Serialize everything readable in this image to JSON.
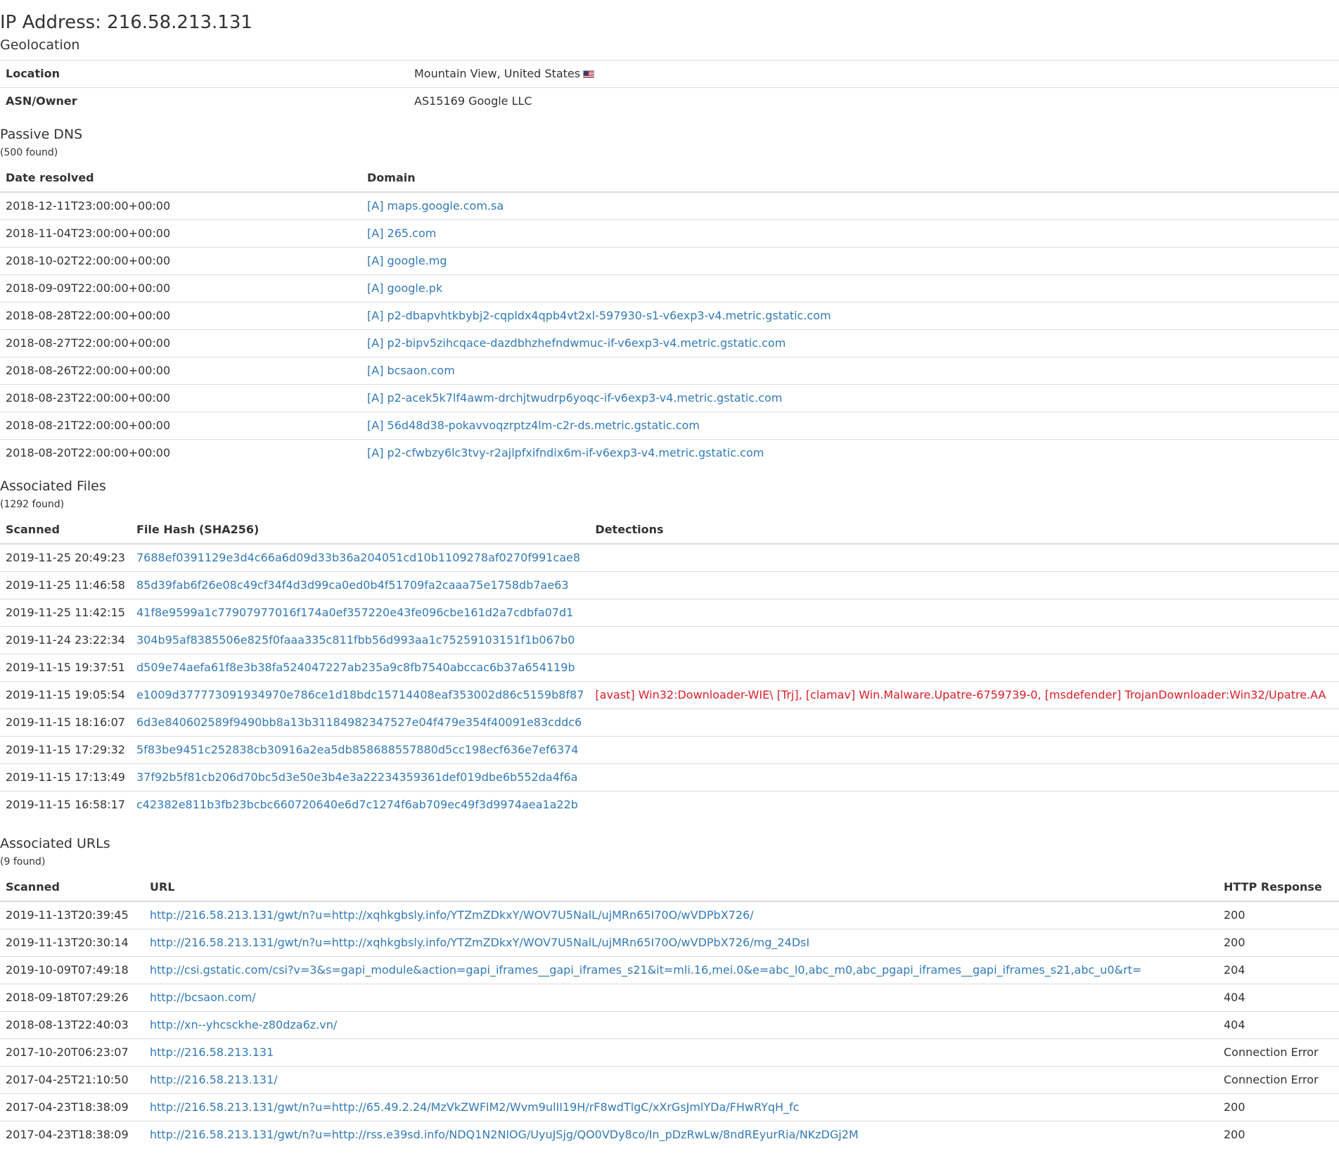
{
  "header": {
    "title": "IP Address: 216.58.213.131",
    "geolocation_heading": "Geolocation"
  },
  "geo": {
    "location_label": "Location",
    "location_value": "Mountain View, United States",
    "flag_icon": "us-flag-icon",
    "asn_label": "ASN/Owner",
    "asn_value": "AS15169 Google LLC"
  },
  "dns": {
    "heading": "Passive DNS",
    "count": "(500 found)",
    "columns": [
      "Date resolved",
      "Domain"
    ],
    "rows": [
      {
        "date": "2018-12-11T23:00:00+00:00",
        "domain": "[A] maps.google.com.sa"
      },
      {
        "date": "2018-11-04T23:00:00+00:00",
        "domain": "[A] 265.com"
      },
      {
        "date": "2018-10-02T22:00:00+00:00",
        "domain": "[A] google.mg"
      },
      {
        "date": "2018-09-09T22:00:00+00:00",
        "domain": "[A] google.pk"
      },
      {
        "date": "2018-08-28T22:00:00+00:00",
        "domain": "[A] p2-dbapvhtkbybj2-cqpldx4qpb4vt2xl-597930-s1-v6exp3-v4.metric.gstatic.com"
      },
      {
        "date": "2018-08-27T22:00:00+00:00",
        "domain": "[A] p2-bipv5zihcqace-dazdbhzhefndwmuc-if-v6exp3-v4.metric.gstatic.com"
      },
      {
        "date": "2018-08-26T22:00:00+00:00",
        "domain": "[A] bcsaon.com"
      },
      {
        "date": "2018-08-23T22:00:00+00:00",
        "domain": "[A] p2-acek5k7lf4awm-drchjtwudrp6yoqc-if-v6exp3-v4.metric.gstatic.com"
      },
      {
        "date": "2018-08-21T22:00:00+00:00",
        "domain": "[A] 56d48d38-pokavvoqzrptz4lm-c2r-ds.metric.gstatic.com"
      },
      {
        "date": "2018-08-20T22:00:00+00:00",
        "domain": "[A] p2-cfwbzy6lc3tvy-r2ajlpfxifndix6m-if-v6exp3-v4.metric.gstatic.com"
      }
    ]
  },
  "files": {
    "heading": "Associated Files",
    "count": "(1292 found)",
    "columns": [
      "Scanned",
      "File Hash (SHA256)",
      "Detections"
    ],
    "rows": [
      {
        "scanned": "2019-11-25 20:49:23",
        "hash": "7688ef0391129e3d4c66a6d09d33b36a204051cd10b1109278af0270f991cae8",
        "detections": ""
      },
      {
        "scanned": "2019-11-25 11:46:58",
        "hash": "85d39fab6f26e08c49cf34f4d3d99ca0ed0b4f51709fa2caaa75e1758db7ae63",
        "detections": ""
      },
      {
        "scanned": "2019-11-25 11:42:15",
        "hash": "41f8e9599a1c77907977016f174a0ef357220e43fe096cbe161d2a7cdbfa07d1",
        "detections": ""
      },
      {
        "scanned": "2019-11-24 23:22:34",
        "hash": "304b95af8385506e825f0faaa335c811fbb56d993aa1c75259103151f1b067b0",
        "detections": ""
      },
      {
        "scanned": "2019-11-15 19:37:51",
        "hash": "d509e74aefa61f8e3b38fa524047227ab235a9c8fb7540abccac6b37a654119b",
        "detections": ""
      },
      {
        "scanned": "2019-11-15 19:05:54",
        "hash": "e1009d377773091934970e786ce1d18bdc15714408eaf353002d86c5159b8f87",
        "detections": "[avast] Win32:Downloader-WIE\\ [Trj], [clamav] Win.Malware.Upatre-6759739-0, [msdefender] TrojanDownloader:Win32/Upatre.AA"
      },
      {
        "scanned": "2019-11-15 18:16:07",
        "hash": "6d3e840602589f9490bb8a13b31184982347527e04f479e354f40091e83cddc6",
        "detections": ""
      },
      {
        "scanned": "2019-11-15 17:29:32",
        "hash": "5f83be9451c252838cb30916a2ea5db858688557880d5cc198ecf636e7ef6374",
        "detections": ""
      },
      {
        "scanned": "2019-11-15 17:13:49",
        "hash": "37f92b5f81cb206d70bc5d3e50e3b4e3a22234359361def019dbe6b552da4f6a",
        "detections": ""
      },
      {
        "scanned": "2019-11-15 16:58:17",
        "hash": "c42382e811b3fb23bcbc660720640e6d7c1274f6ab709ec49f3d9974aea1a22b",
        "detections": ""
      }
    ]
  },
  "urls": {
    "heading": "Associated URLs",
    "count": "(9 found)",
    "columns": [
      "Scanned",
      "URL",
      "HTTP Response"
    ],
    "rows": [
      {
        "scanned": "2019-11-13T20:39:45",
        "url": "http://216.58.213.131/gwt/n?u=http://xqhkgbsly.info/YTZmZDkxY/WOV7U5NalL/ujMRn65I70O/wVDPbX726/",
        "response": "200"
      },
      {
        "scanned": "2019-11-13T20:30:14",
        "url": "http://216.58.213.131/gwt/n?u=http://xqhkgbsly.info/YTZmZDkxY/WOV7U5NalL/ujMRn65I70O/wVDPbX726/mg_24DsI",
        "response": "200"
      },
      {
        "scanned": "2019-10-09T07:49:18",
        "url": "http://csi.gstatic.com/csi?v=3&s=gapi_module&action=gapi_iframes__gapi_iframes_s21&it=mli.16,mei.0&e=abc_l0,abc_m0,abc_pgapi_iframes__gapi_iframes_s21,abc_u0&rt=",
        "response": "204"
      },
      {
        "scanned": "2018-09-18T07:29:26",
        "url": "http://bcsaon.com/",
        "response": "404"
      },
      {
        "scanned": "2018-08-13T22:40:03",
        "url": "http://xn--yhcsckhe-z80dza6z.vn/",
        "response": "404"
      },
      {
        "scanned": "2017-10-20T06:23:07",
        "url": "http://216.58.213.131",
        "response": "Connection Error"
      },
      {
        "scanned": "2017-04-25T21:10:50",
        "url": "http://216.58.213.131/",
        "response": "Connection Error"
      },
      {
        "scanned": "2017-04-23T18:38:09",
        "url": "http://216.58.213.131/gwt/n?u=http://65.49.2.24/MzVkZWFlM2/Wvm9ulII19H/rF8wdTlgC/xXrGsJmlYDa/FHwRYqH_fc",
        "response": "200"
      },
      {
        "scanned": "2017-04-23T18:38:09",
        "url": "http://216.58.213.131/gwt/n?u=http://rss.e39sd.info/NDQ1N2NlOG/UyuJSjg/QO0VDy8co/In_pDzRwLw/8ndREyurRia/NKzDGj2M",
        "response": "200"
      }
    ]
  },
  "colors": {
    "link": "#337ab7",
    "detection": "#d9202a",
    "text": "#333333",
    "border": "#dddddd"
  }
}
